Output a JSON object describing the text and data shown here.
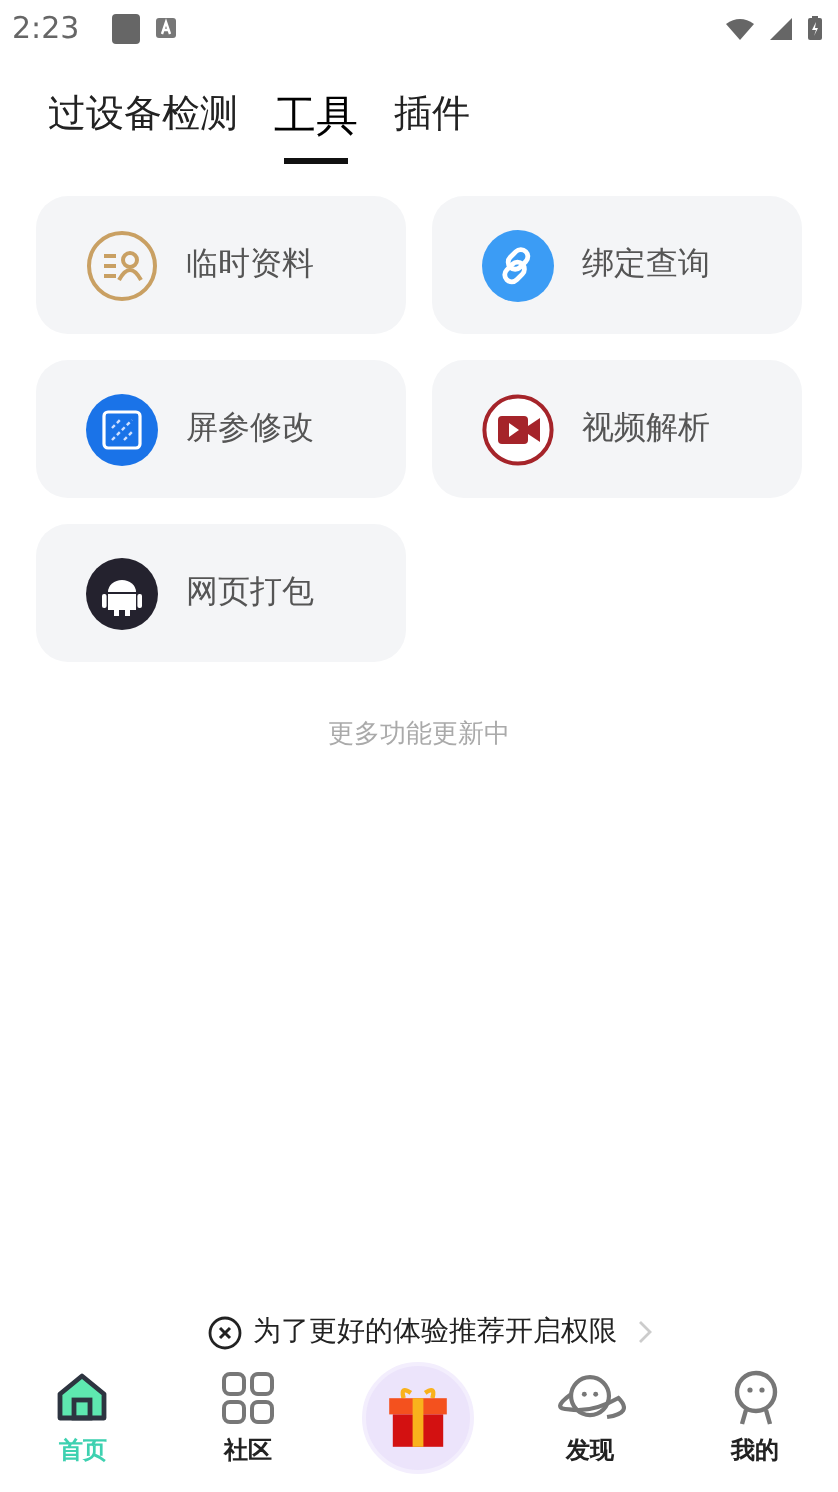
{
  "status_bar": {
    "time": "2:23"
  },
  "tabs": [
    {
      "label": "过设备检测",
      "selected": false
    },
    {
      "label": "工具",
      "selected": true
    },
    {
      "label": "插件",
      "selected": false
    }
  ],
  "tools": [
    {
      "label": "临时资料",
      "kind": "person"
    },
    {
      "label": "绑定查询",
      "kind": "link"
    },
    {
      "label": "屏参修改",
      "kind": "screen"
    },
    {
      "label": "视频解析",
      "kind": "video"
    },
    {
      "label": "网页打包",
      "kind": "android"
    }
  ],
  "footer_note": "更多功能更新中",
  "permission_notice": {
    "text": "为了更好的体验推荐开启权限"
  },
  "nav": [
    {
      "label": "首页",
      "kind": "home",
      "selected": true
    },
    {
      "label": "社区",
      "kind": "grid",
      "selected": false
    },
    {
      "kind": "gift",
      "selected": false
    },
    {
      "label": "发现",
      "kind": "planet",
      "selected": false
    },
    {
      "label": "我的",
      "kind": "user",
      "selected": false
    }
  ]
}
